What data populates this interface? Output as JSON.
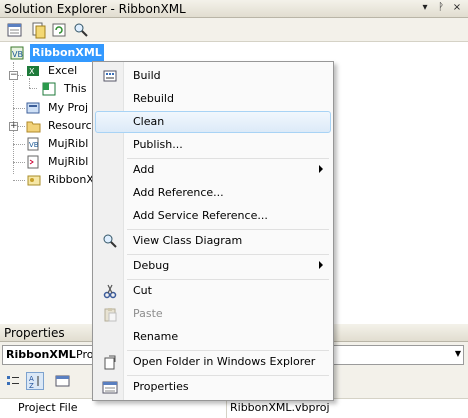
{
  "solution_explorer": {
    "title": "Solution Explorer - RibbonXML",
    "title_buttons": [
      "▾",
      "ᚹ",
      "×"
    ],
    "tree": [
      {
        "label": "RibbonXML",
        "icon": "vb-project-icon",
        "selected": true
      },
      {
        "label": "Excel",
        "icon": "excel-folder-icon"
      },
      {
        "label": "This",
        "icon": "excel-sheet-icon"
      },
      {
        "label": "My Proj",
        "icon": "my-project-icon"
      },
      {
        "label": "Resourc",
        "icon": "folder-icon"
      },
      {
        "label": "MujRibl",
        "icon": "vb-file-icon"
      },
      {
        "label": "MujRibl",
        "icon": "xml-file-icon"
      },
      {
        "label": "RibbonX",
        "icon": "key-file-icon"
      }
    ]
  },
  "context_menu": {
    "items": [
      {
        "label": "Build",
        "icon": "build-icon"
      },
      {
        "label": "Rebuild"
      },
      {
        "label": "Clean",
        "hover": true
      },
      {
        "label": "Publish..."
      },
      {
        "label": "Add",
        "submenu": true
      },
      {
        "label": "Add Reference..."
      },
      {
        "label": "Add Service Reference..."
      },
      {
        "label": "View Class Diagram",
        "icon": "class-diagram-icon"
      },
      {
        "label": "Debug",
        "submenu": true
      },
      {
        "label": "Cut",
        "icon": "scissors-icon"
      },
      {
        "label": "Paste",
        "icon": "paste-icon",
        "disabled": true
      },
      {
        "label": "Rename"
      },
      {
        "label": "Open Folder in Windows Explorer",
        "icon": "open-folder-icon"
      },
      {
        "label": "Properties",
        "icon": "properties-icon"
      }
    ]
  },
  "properties": {
    "title": "Properties",
    "object_name": "RibbonXML",
    "object_type": "Pro",
    "row": {
      "key": "Project File",
      "value": "RibbonXML.vbproj"
    }
  },
  "colors": {
    "selection": "#3399ff",
    "menu_hover_border": "#a8d3f5"
  }
}
